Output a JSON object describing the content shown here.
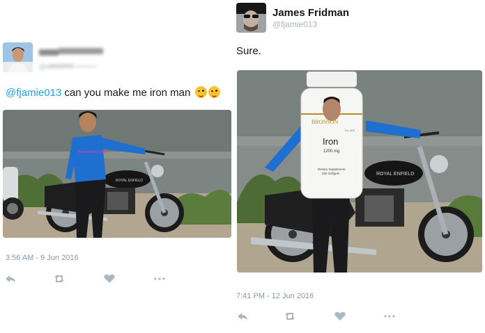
{
  "left_tweet": {
    "mention": "@fjamie013",
    "text": " can you make  me iron man ",
    "emojis": [
      "winking-face-emoji",
      "winking-face-emoji"
    ],
    "timestamp": "3:56 AM - 9 Jun 2016"
  },
  "right_tweet": {
    "name": "James Fridman",
    "handle": "@fjamie013",
    "text": "Sure.",
    "timestamp": "7:41 PM - 12 Jun 2016",
    "bottle": {
      "brand": "BRONSON",
      "product": "Iron",
      "dose": "1200 mg",
      "line1": "Dietary Supplement",
      "line2": "250 Softgels",
      "corner": "No. 600"
    }
  },
  "motorcycle": {
    "brand_text": "ROYAL ENFIELD"
  },
  "shirt_text": "Homemade is Best",
  "actions": [
    "reply-icon",
    "retweet-icon",
    "like-icon",
    "more-icon"
  ],
  "colors": {
    "link": "#1da1f2",
    "meta": "#8899a6",
    "icon": "#aab8c2",
    "shirt": "#1f6fd1"
  }
}
